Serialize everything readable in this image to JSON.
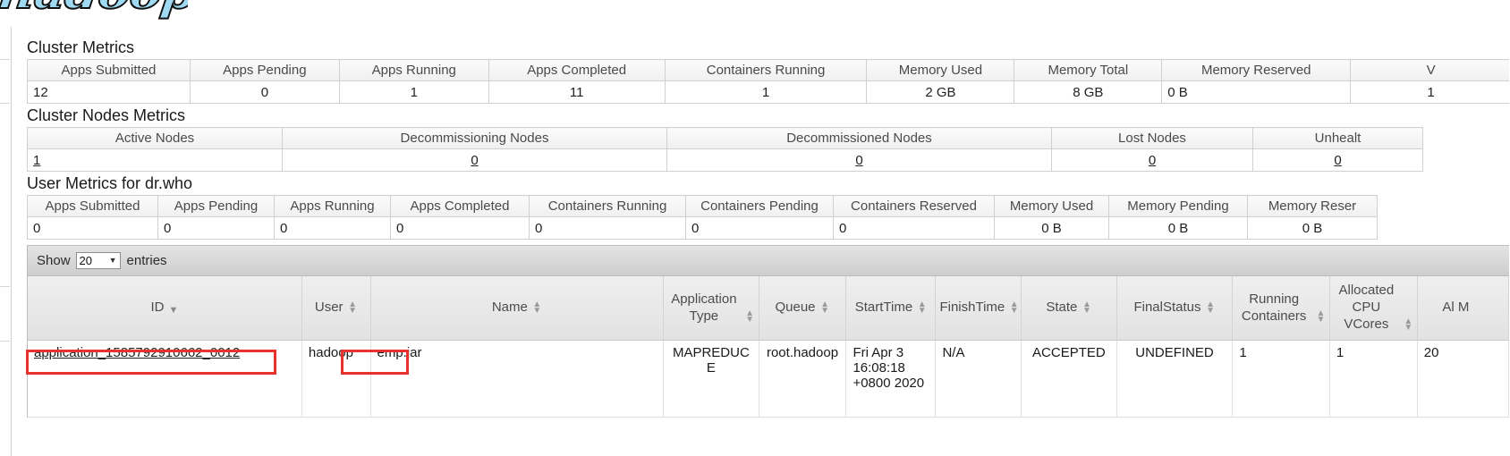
{
  "branding": {
    "logo_text": "hadoop"
  },
  "cluster_metrics": {
    "title": "Cluster Metrics",
    "headers": [
      "Apps Submitted",
      "Apps Pending",
      "Apps Running",
      "Apps Completed",
      "Containers Running",
      "Memory Used",
      "Memory Total",
      "Memory Reserved",
      "V"
    ],
    "values": [
      "12",
      "0",
      "1",
      "11",
      "1",
      "2 GB",
      "8 GB",
      "0 B",
      "1"
    ]
  },
  "cluster_nodes_metrics": {
    "title": "Cluster Nodes Metrics",
    "headers": [
      "Active Nodes",
      "Decommissioning Nodes",
      "Decommissioned Nodes",
      "Lost Nodes",
      "Unhealt"
    ],
    "values": [
      "1",
      "0",
      "0",
      "0",
      "0"
    ]
  },
  "user_metrics": {
    "title": "User Metrics for dr.who",
    "headers": [
      "Apps Submitted",
      "Apps Pending",
      "Apps Running",
      "Apps Completed",
      "Containers Running",
      "Containers Pending",
      "Containers Reserved",
      "Memory Used",
      "Memory Pending",
      "Memory Reser"
    ],
    "values": [
      "0",
      "0",
      "0",
      "0",
      "0",
      "0",
      "0",
      "0 B",
      "0 B",
      "0 B"
    ]
  },
  "datatable": {
    "show_label": "Show",
    "entries_label": "entries",
    "page_length": "20",
    "caret": "▼",
    "columns": [
      {
        "label": "ID",
        "sort": "desc"
      },
      {
        "label": "User",
        "sort": "none"
      },
      {
        "label": "Name",
        "sort": "none"
      },
      {
        "label": "Application Type",
        "sort": "none"
      },
      {
        "label": "Queue",
        "sort": "none"
      },
      {
        "label": "StartTime",
        "sort": "none"
      },
      {
        "label": "FinishTime",
        "sort": "none"
      },
      {
        "label": "State",
        "sort": "none"
      },
      {
        "label": "FinalStatus",
        "sort": "none"
      },
      {
        "label": "Running Containers",
        "sort": "none"
      },
      {
        "label": "Allocated CPU VCores",
        "sort": "none"
      },
      {
        "label": "Al M",
        "sort": "none"
      }
    ],
    "rows": [
      {
        "id": "application_1585792910662_0012",
        "user": "hadoop",
        "name": "emp.jar",
        "application_type": "MAPREDUCE",
        "queue": "root.hadoop",
        "start_time": "Fri Apr 3 16:08:18 +0800 2020",
        "finish_time": "N/A",
        "state": "ACCEPTED",
        "final_status": "UNDEFINED",
        "running_containers": "1",
        "allocated_cpu_vcores": "1",
        "allocated_memory": "20"
      }
    ]
  },
  "annotations": {
    "color": "#e8322a",
    "boxes": [
      "application-id-link",
      "application-name-cell"
    ]
  }
}
